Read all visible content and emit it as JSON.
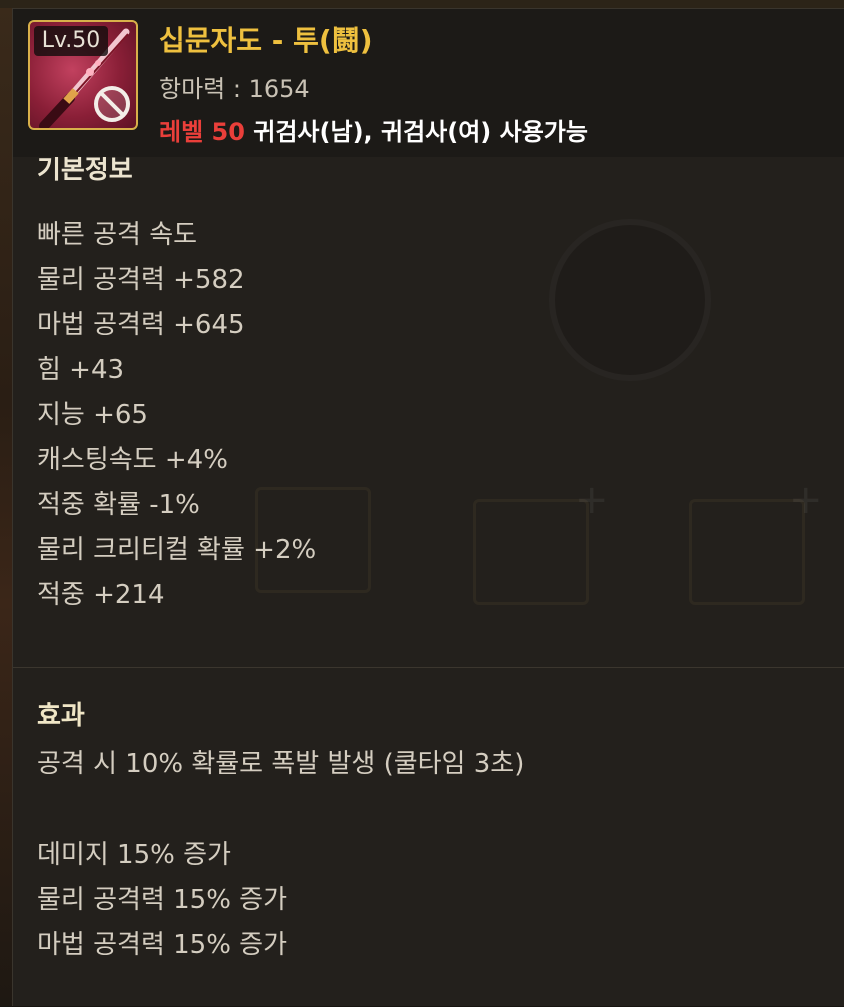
{
  "item": {
    "level_badge": "Lv.50",
    "name": "십문자도 - 투(鬪)",
    "defense": "항마력 : 1654",
    "requirement_level": "레벨 50",
    "requirement_classes": " 귀검사(남), 귀검사(여) 사용가능",
    "icon": "katana-icon",
    "status_icon": "no-entry-icon"
  },
  "basic_info": {
    "title": "기본정보",
    "stats": [
      "빠른 공격 속도",
      "물리 공격력 +582",
      "마법 공격력 +645",
      "힘 +43",
      "지능 +65",
      "캐스팅속도 +4%",
      "적중 확률 -1%",
      "물리 크리티컬 확률 +2%",
      "적중 +214"
    ]
  },
  "effect": {
    "title": "효과",
    "main": "공격 시 10% 확률로 폭발 발생 (쿨타임 3초)",
    "lines": [
      "데미지 15% 증가",
      "물리 공격력 15% 증가",
      "마법 공격력 15% 증가"
    ]
  },
  "colors": {
    "item_name": "#eec03f",
    "requirement_level": "#ea3f3a",
    "icon_border": "#d8b04a"
  }
}
